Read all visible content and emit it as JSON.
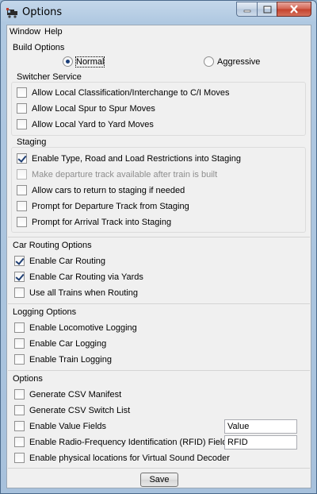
{
  "window": {
    "title": "Options",
    "caption": {
      "minimize": "—",
      "maximize": "□",
      "close": "✕"
    }
  },
  "menu": {
    "items": [
      "Window",
      "Help"
    ]
  },
  "build_options": {
    "title": "Build Options",
    "normal_label": "Normal",
    "aggressive_label": "Aggressive",
    "selected": "Normal"
  },
  "switcher": {
    "title": "Switcher Service",
    "items": [
      {
        "label": "Allow Local Classification/Interchange to C/I Moves",
        "checked": false
      },
      {
        "label": "Allow Local Spur to Spur Moves",
        "checked": false
      },
      {
        "label": "Allow Local Yard to Yard Moves",
        "checked": false
      }
    ]
  },
  "staging": {
    "title": "Staging",
    "items": [
      {
        "label": "Enable Type, Road and Load Restrictions into Staging",
        "checked": true
      },
      {
        "label": "Make departure track available after train is built",
        "checked": false,
        "disabled": true
      },
      {
        "label": "Allow cars to return to staging if needed",
        "checked": false
      },
      {
        "label": "Prompt for Departure Track from Staging",
        "checked": false
      },
      {
        "label": "Prompt for Arrival Track into Staging",
        "checked": false
      }
    ]
  },
  "car_routing": {
    "title": "Car Routing Options",
    "items": [
      {
        "label": "Enable Car Routing",
        "checked": true
      },
      {
        "label": "Enable Car Routing via Yards",
        "checked": true
      },
      {
        "label": "Use all Trains when Routing",
        "checked": false
      }
    ]
  },
  "logging": {
    "title": "Logging Options",
    "items": [
      {
        "label": "Enable Locomotive Logging",
        "checked": false
      },
      {
        "label": "Enable Car Logging",
        "checked": false
      },
      {
        "label": "Enable Train Logging",
        "checked": false
      }
    ]
  },
  "options": {
    "title": "Options",
    "items": [
      {
        "label": "Generate CSV Manifest",
        "checked": false
      },
      {
        "label": "Generate CSV Switch List",
        "checked": false
      },
      {
        "label": "Enable Value Fields",
        "checked": false
      },
      {
        "label": "Enable Radio-Frequency Identification (RFID) Fields",
        "checked": false
      },
      {
        "label": "Enable physical locations for Virtual Sound Decoder",
        "checked": false
      }
    ],
    "value_field": "Value",
    "rfid_field": "RFID"
  },
  "save_label": "Save",
  "colors": {
    "check_mark": "#1f3f73",
    "disabled_text": "#8d8d8d",
    "close_button": "#c4412c"
  }
}
